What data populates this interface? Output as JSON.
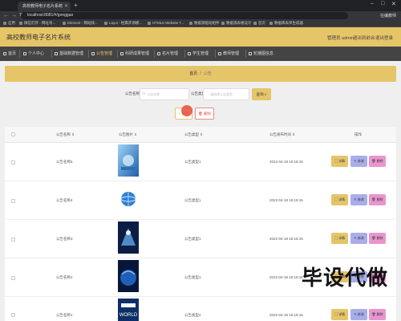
{
  "browser": {
    "tab_title": "高校教师电子名片系统",
    "url": "localhost:8081/#/gonggao",
    "account": "在编教师",
    "bookmarks": [
      "应用",
      "微信打开 - 网址导...",
      "Element - 网站快...",
      "Layui - 经典开源模...",
      "HTML5 Website T...",
      "数据源驱动组件",
      "数据源表格设计",
      "首页",
      "数据库表单生成器"
    ]
  },
  "header": {
    "title": "高校教师电子名片系统",
    "admin": "管理员 admin",
    "to_front": "退出到前台",
    "logout": "退出登录"
  },
  "menu": [
    {
      "label": "首页",
      "icon": "home-icon"
    },
    {
      "label": "个人中心",
      "icon": "user-icon"
    },
    {
      "label": "基础数据管理",
      "icon": "database-icon"
    },
    {
      "label": "公告管理",
      "icon": "notice-icon",
      "active": true
    },
    {
      "label": "科研成果管理",
      "icon": "book-icon"
    },
    {
      "label": "名片管理",
      "icon": "card-icon"
    },
    {
      "label": "学生管理",
      "icon": "student-icon"
    },
    {
      "label": "教师管理",
      "icon": "teacher-icon"
    },
    {
      "label": "轮播图信息",
      "icon": "image-icon"
    }
  ],
  "breadcrumb": {
    "home": "首页",
    "current": "公告"
  },
  "search": {
    "name_label": "公告名称",
    "name_placeholder": "公告名称",
    "type_label": "公告类型",
    "type_placeholder": "请选择公告类型",
    "button": "查询"
  },
  "actions": {
    "add": "+ 新增",
    "delete": "删除"
  },
  "table": {
    "headers": [
      "公告名称",
      "公告图片",
      "公告类型",
      "公告发布时间",
      "操作"
    ],
    "rows": [
      {
        "name": "公告名称5",
        "type": "公告类型1",
        "time": "2022-04-18 15:18:16"
      },
      {
        "name": "公告名称4",
        "type": "公告类型1",
        "time": "2022-04-18 15:18:16"
      },
      {
        "name": "公告名称3",
        "type": "公告类型1",
        "time": "2022-04-18 15:18:16"
      },
      {
        "name": "公告名称2",
        "type": "公告类型1",
        "time": "2022-04-18 15:18:16"
      },
      {
        "name": "公告名称1",
        "type": "公告类型2",
        "time": "2022-04-18 15:18:16"
      }
    ],
    "btn_detail": "详情",
    "btn_edit": "修改",
    "btn_delete": "删除"
  },
  "watermark": "毕设代做",
  "thumb_text": "WORLD",
  "colors": {
    "accent": "#e6c569",
    "edit": "#a9aeea",
    "delete": "#e995cf",
    "menu_bg": "#444444"
  }
}
